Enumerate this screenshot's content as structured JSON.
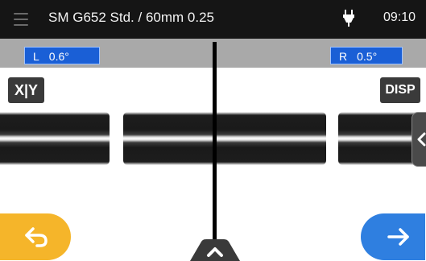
{
  "status_bar": {
    "title": "SM G652 Std. / 60mm 0.25",
    "time": "09:10",
    "icons": [
      "menu-icon",
      "plug-icon"
    ]
  },
  "angles": {
    "left_prefix": "L",
    "left_value": "0.6°",
    "right_prefix": "R",
    "right_value": "0.5°"
  },
  "view": {
    "xy_label": "X|Y",
    "disp_label": "DISP",
    "icons": [
      "chevron-left-icon",
      "chevron-up-icon"
    ]
  },
  "nav": {
    "back_icon": "return-arrow-icon",
    "next_icon": "right-arrow-icon"
  },
  "colors": {
    "back_button": "#f5b52a",
    "next_button": "#2f7fe0",
    "angle_box": "#1a5fd6"
  }
}
